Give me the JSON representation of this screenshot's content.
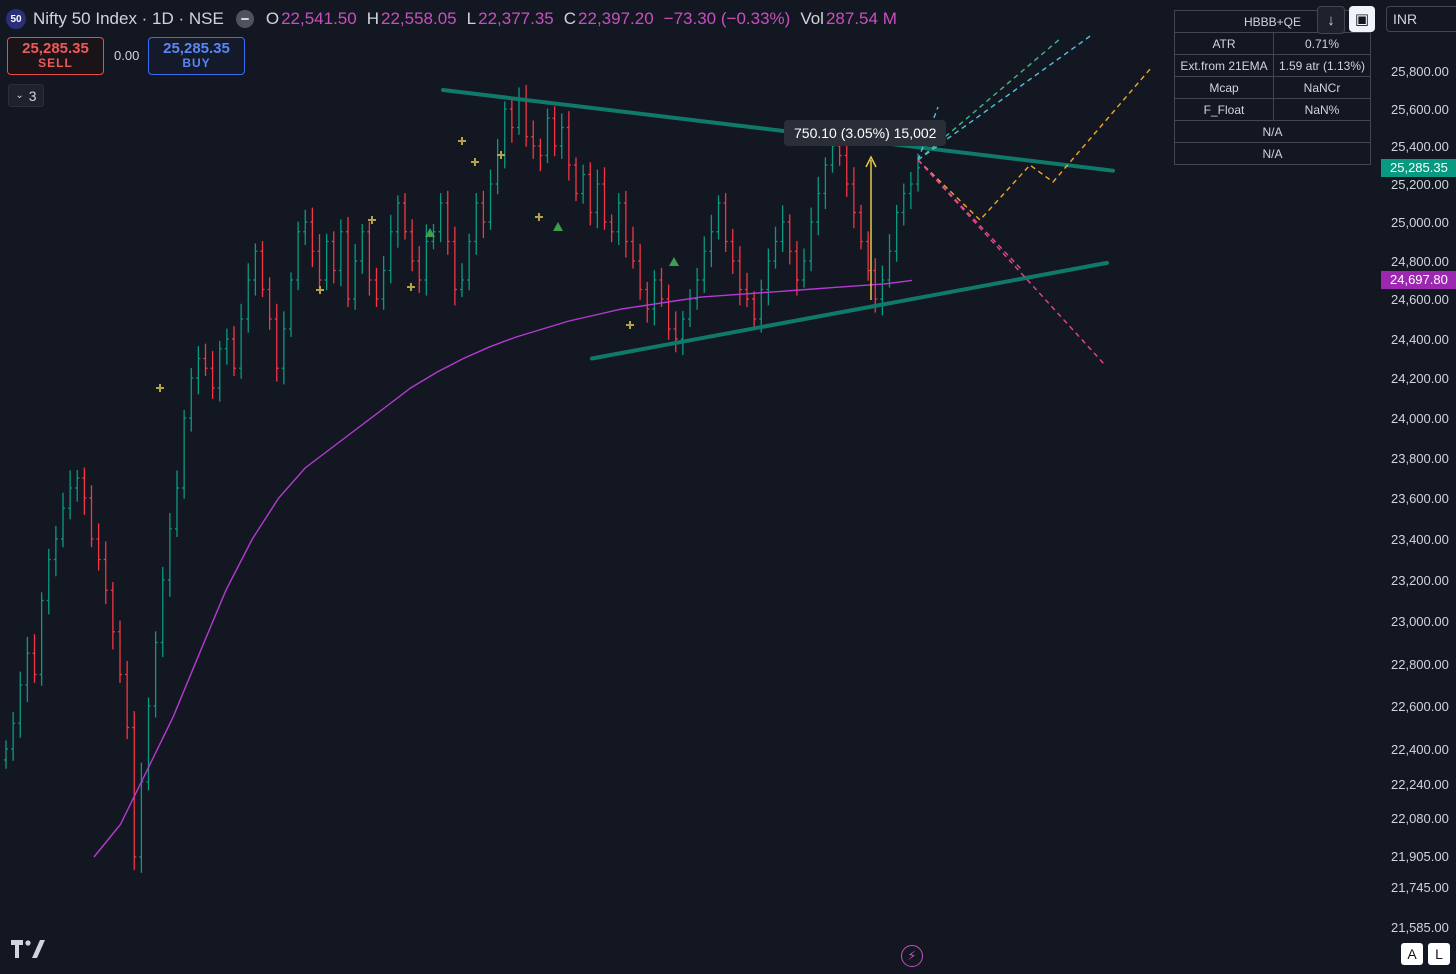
{
  "header": {
    "symbol_badge": "50",
    "title": "Nifty 50 Index · 1D · NSE",
    "ohlc": [
      {
        "label": "O",
        "value": "22,541.50"
      },
      {
        "label": "H",
        "value": "22,558.05"
      },
      {
        "label": "L",
        "value": "22,377.35"
      },
      {
        "label": "C",
        "value": "22,397.20"
      },
      {
        "label": "",
        "value": "−73.30 (−0.33%)"
      },
      {
        "label": "Vol",
        "value": "287.54 M"
      }
    ]
  },
  "trade": {
    "sell_price": "25,285.35",
    "sell_label": "SELL",
    "spread": "0.00",
    "buy_price": "25,285.35",
    "buy_label": "BUY"
  },
  "indicators_toggle": "3",
  "toolbar": {
    "currency": "INR",
    "down_icon": "arrow-down-icon",
    "layout_icon": "layout-icon"
  },
  "info_table": {
    "title": "HBBB+QE",
    "rows": [
      {
        "key": "ATR",
        "value": "0.71%"
      },
      {
        "key": "Ext.from 21EMA",
        "value": "1.59 atr (1.13%)"
      },
      {
        "key": "Mcap",
        "value": "NaNCr"
      },
      {
        "key": "F_Float",
        "value": "NaN%"
      }
    ],
    "footer_rows": [
      "N/A",
      "N/A"
    ]
  },
  "price_tags": [
    {
      "value": "25,285.35",
      "price": 25285.35,
      "color": "#089981"
    },
    {
      "value": "24,697.80",
      "price": 24697.8,
      "color": "#9c27b0"
    }
  ],
  "measure_label": "750.10 (3.05%) 15,002",
  "bottom": {
    "btn_a": "A",
    "btn_l": "L"
  },
  "colors": {
    "background": "#131722",
    "up": "#089981",
    "down": "#f23645",
    "ema": "#b43ad1",
    "trendline": "#0f7a6a",
    "grid_text": "#d1d4dc"
  },
  "chart_data": {
    "type": "candlestick",
    "y_axis": {
      "ticks": [
        "25,800.00",
        "25,600.00",
        "25,400.00",
        "25,200.00",
        "25,000.00",
        "24,800.00",
        "24,600.00",
        "24,400.00",
        "24,200.00",
        "24,000.00",
        "23,800.00",
        "23,600.00",
        "23,400.00",
        "23,200.00",
        "23,000.00",
        "22,800.00",
        "22,600.00",
        "22,400.00",
        "22,240.00",
        "22,080.00",
        "21,905.00",
        "21,745.00",
        "21,585.00"
      ],
      "tick_values": [
        25800,
        25600,
        25400,
        25200,
        25000,
        24800,
        24600,
        24400,
        24200,
        24000,
        23800,
        23600,
        23400,
        23200,
        23000,
        22800,
        22600,
        22400,
        22240,
        22080,
        21905,
        21745,
        21585
      ],
      "scale": "log-like (non-uniform)"
    },
    "series": [
      {
        "type": "candles",
        "closes": [
          22400,
          22520,
          22700,
          22850,
          22750,
          23100,
          23300,
          23400,
          23550,
          23650,
          23700,
          23600,
          23400,
          23300,
          23150,
          22950,
          22750,
          22500,
          21900,
          22250,
          22600,
          22900,
          23200,
          23450,
          23650,
          24000,
          24200,
          24300,
          24250,
          24150,
          24350,
          24400,
          24250,
          24500,
          24700,
          24850,
          24650,
          24500,
          24250,
          24450,
          24700,
          24950,
          25000,
          24850,
          24700,
          24900,
          24750,
          24950,
          24600,
          24800,
          24950,
          24700,
          24600,
          24750,
          24950,
          25100,
          24950,
          24800,
          24700,
          24900,
          24950,
          25100,
          24900,
          24650,
          24700,
          24900,
          25100,
          25000,
          25200,
          25350,
          25600,
          25500,
          25650,
          25450,
          25400,
          25350,
          25550,
          25400,
          25500,
          25300,
          25150,
          25250,
          25050,
          25200,
          25000,
          24950,
          25100,
          24900,
          24800,
          24650,
          24550,
          24700,
          24600,
          24450,
          24400,
          24500,
          24600,
          24700,
          24850,
          24950,
          25100,
          24900,
          24800,
          24650,
          24600,
          24500,
          24650,
          24800,
          24900,
          25000,
          24850,
          24700,
          24800,
          25000,
          25150,
          25300,
          25400,
          25350,
          25200,
          25050,
          24900,
          24750,
          24600,
          24700,
          24850,
          25050,
          25150,
          25200,
          25285.35
        ]
      },
      {
        "type": "line",
        "name": "",
        "values": [
          21900,
          22050,
          22300,
          22550,
          22850,
          23150,
          23400,
          23600,
          23750,
          23850,
          23950,
          24050,
          24150,
          24230,
          24300,
          24360,
          24410,
          24450,
          24490,
          24520,
          24550,
          24570,
          24590,
          24610,
          24620,
          24630,
          24640,
          24650,
          24660,
          24670,
          24680,
          24697.8
        ]
      }
    ],
    "trendlines": [
      {
        "from": {
          "i": 0.0,
          "p": 25700
        },
        "to": {
          "i": 1.0,
          "p": 25270
        }
      },
      {
        "from": {
          "i": 0.0,
          "p": 24300
        },
        "to": {
          "i": 1.0,
          "p": 24790
        }
      }
    ]
  }
}
